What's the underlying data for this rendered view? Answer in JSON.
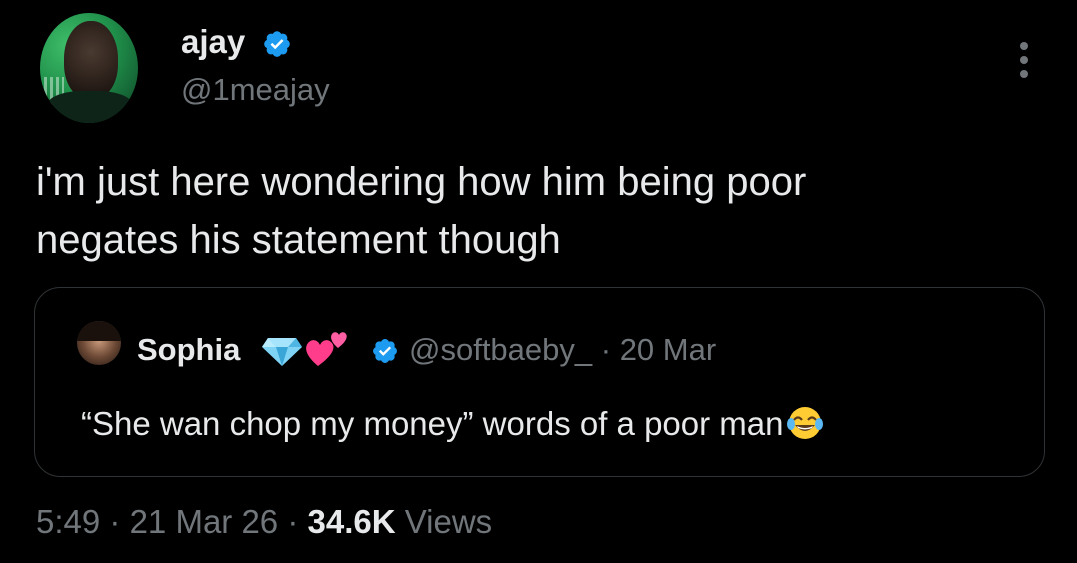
{
  "author": {
    "display_name": "ajay",
    "handle": "@1meajay",
    "verified": true,
    "verified_color": "#1d9bf0"
  },
  "tweet": {
    "text_line1": "i'm just here wondering how him being poor",
    "text_line2": "negates his statement though"
  },
  "quote": {
    "display_name": "Sophia",
    "name_emojis": [
      "gem-stone-emoji",
      "two-hearts-emoji"
    ],
    "verified": true,
    "handle_and_date": "@softbaeby_ · 20 Mar",
    "text": "“She wan chop my money” words of a poor man",
    "trailing_emoji": "face-with-tears-of-joy-emoji"
  },
  "meta": {
    "time": "5:49",
    "date": "21 Mar 26",
    "views_count": "34.6K",
    "views_label": "Views",
    "separator": "·"
  },
  "colors": {
    "background": "#000000",
    "primary_text": "#e7e9ea",
    "secondary_text": "#71767b",
    "border": "#2f3336",
    "verified_blue": "#1d9bf0"
  }
}
